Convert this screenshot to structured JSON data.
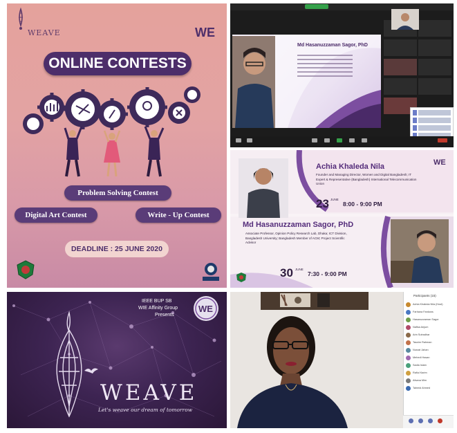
{
  "contest_poster": {
    "brand": "WEAVE",
    "title": "ONLINE CONTESTS",
    "contests": [
      "Problem Solving Contest",
      "Digital Art Contest",
      "Write - Up Contest"
    ],
    "deadline": "DEADLINE : 25 JUNE 2020",
    "footer_logo": "IEEE BUP"
  },
  "zoom_meeting": {
    "slide_title": "Md Hasanuzzaman Sagor, PhD",
    "side_participants": [
      "",
      "",
      "",
      "",
      "",
      "",
      "",
      ""
    ]
  },
  "schedule": {
    "speaker1": {
      "name": "Achia Khaleda Nila",
      "description": "Founder and Managing Director, Women and Digital Bangladesh; IT Expert & Representative (Bangladesh) International Telecommunication Union",
      "date": "23",
      "month": "JUNE",
      "time": "8:00 - 9:00 PM"
    },
    "speaker2": {
      "name": "Md Hasanuzzaman Sagor, PhD",
      "description": "Associate Professor, Opinion Policy Research Lab, Dhaka; ICT Division, Bangladesh University; Bangladesh Member of ACM; Project Scientific Advisor",
      "date": "30",
      "month": "JUNE",
      "time": "7:30 - 9:00 PM"
    }
  },
  "weave_poster": {
    "org_line1": "IEEE BUP SB",
    "org_line2": "WIE Affinity Group",
    "presents": "Presents",
    "brand": "WEAVE",
    "tagline": "Let's weave our dream of tomorrow",
    "badge": "WE"
  },
  "video_call": {
    "participants_title": "Participants (15)",
    "participants": [
      "Achia Khaleda Nila (Host)",
      "Farhana Fardows",
      "Hasanuzzaman Sagor",
      "Nafisa Anjum",
      "Arin Sutradhar",
      "Tasnim Rahman",
      "Nusrat Jahan",
      "Mehedi Hasan",
      "Sadia Islam",
      "Rafiul Karim",
      "Afsana Mim",
      "Tahmid Ahmed"
    ],
    "colors": {
      "avatar1": "#c7892f",
      "avatar2": "#4a78c2",
      "avatar3": "#6e9e4a",
      "avatar4": "#b04a6a"
    }
  },
  "colors": {
    "brand_purple": "#4d2e6a",
    "pink_bg": "#e4a29c",
    "dark_purple": "#2b1738"
  }
}
